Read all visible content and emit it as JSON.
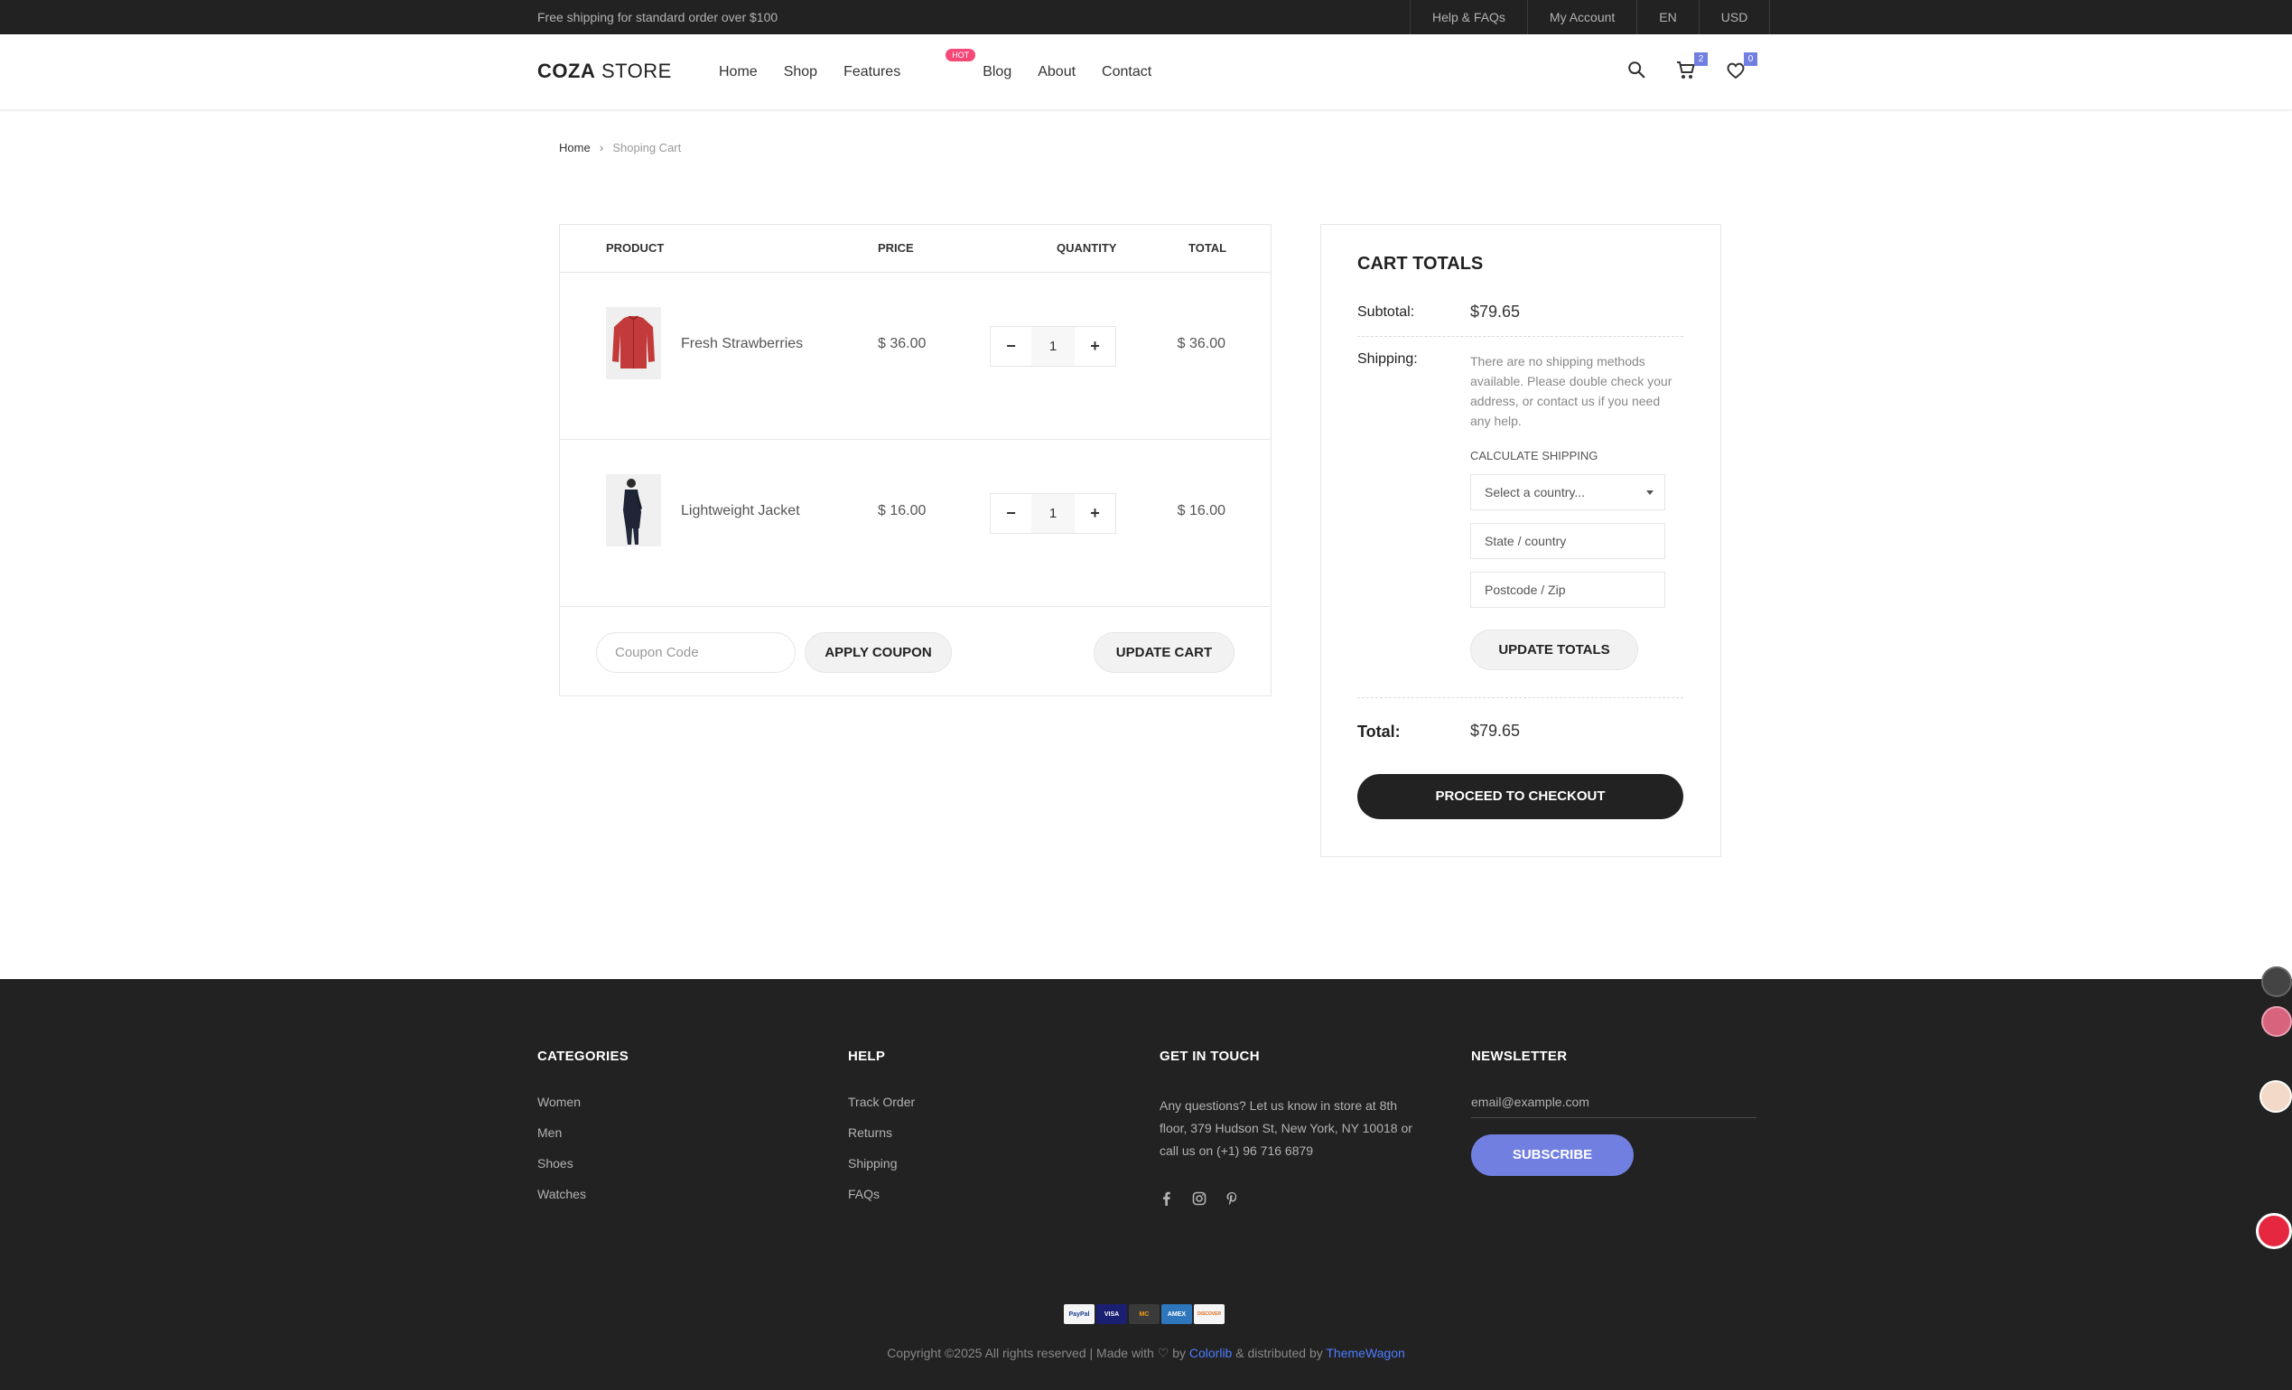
{
  "topbar": {
    "promo": "Free shipping for standard order over $100",
    "links": [
      "Help & FAQs",
      "My Account",
      "EN",
      "USD"
    ]
  },
  "header": {
    "logo_bold": "COZA",
    "logo_rest": " STORE",
    "nav": [
      "Home",
      "Shop",
      "Features",
      "Blog",
      "About",
      "Contact"
    ],
    "hot_badge": "HOT",
    "cart_count": "2",
    "wishlist_count": "0",
    "icons": [
      "search-icon",
      "cart-icon",
      "heart-icon"
    ]
  },
  "breadcrumb": {
    "home": "Home",
    "current": "Shoping Cart"
  },
  "cart": {
    "headers": {
      "product": "PRODUCT",
      "price": "PRICE",
      "quantity": "QUANTITY",
      "total": "TOTAL"
    },
    "items": [
      {
        "name": "Fresh Strawberries",
        "price": "$ 36.00",
        "qty": "1",
        "total": "$ 36.00"
      },
      {
        "name": "Lightweight Jacket",
        "price": "$ 16.00",
        "qty": "1",
        "total": "$ 16.00"
      }
    ],
    "minus": "−",
    "plus": "+",
    "coupon_placeholder": "Coupon Code",
    "apply_coupon": "APPLY COUPON",
    "update_cart": "UPDATE CART"
  },
  "totals": {
    "title": "CART TOTALS",
    "subtotal_label": "Subtotal:",
    "subtotal_value": "$79.65",
    "shipping_label": "Shipping:",
    "shipping_note": "There are no shipping methods available. Please double check your address, or contact us if you need any help.",
    "calc_label": "CALCULATE SHIPPING",
    "country_select": "Select a country...",
    "state_placeholder": "State /  country",
    "postcode_placeholder": "Postcode / Zip",
    "update_totals": "UPDATE TOTALS",
    "total_label": "Total:",
    "total_value": "$79.65",
    "checkout": "PROCEED TO CHECKOUT"
  },
  "footer": {
    "categories": {
      "title": "CATEGORIES",
      "items": [
        "Women",
        "Men",
        "Shoes",
        "Watches"
      ]
    },
    "help": {
      "title": "HELP",
      "items": [
        "Track Order",
        "Returns",
        "Shipping",
        "FAQs"
      ]
    },
    "touch": {
      "title": "GET IN TOUCH",
      "text": "Any questions? Let us know in store at 8th floor, 379 Hudson St, New York, NY 10018 or call us on (+1) 96 716 6879",
      "social": [
        "facebook-icon",
        "instagram-icon",
        "pinterest-icon"
      ]
    },
    "newsletter": {
      "title": "NEWSLETTER",
      "email": "email@example.com",
      "subscribe": "SUBSCRIBE"
    },
    "payments": [
      "PayPal",
      "VISA",
      "MC",
      "AMEX",
      "DISCOVER"
    ],
    "copyright_prefix": "Copyright ©2025 All rights reserved | Made with",
    "by": "by",
    "colorlib": "Colorlib",
    "distributed": "& distributed by",
    "themewagon": "ThemeWagon"
  },
  "colors": {
    "accent": "#717fe0",
    "dark": "#222222",
    "hot": "#f74877"
  }
}
